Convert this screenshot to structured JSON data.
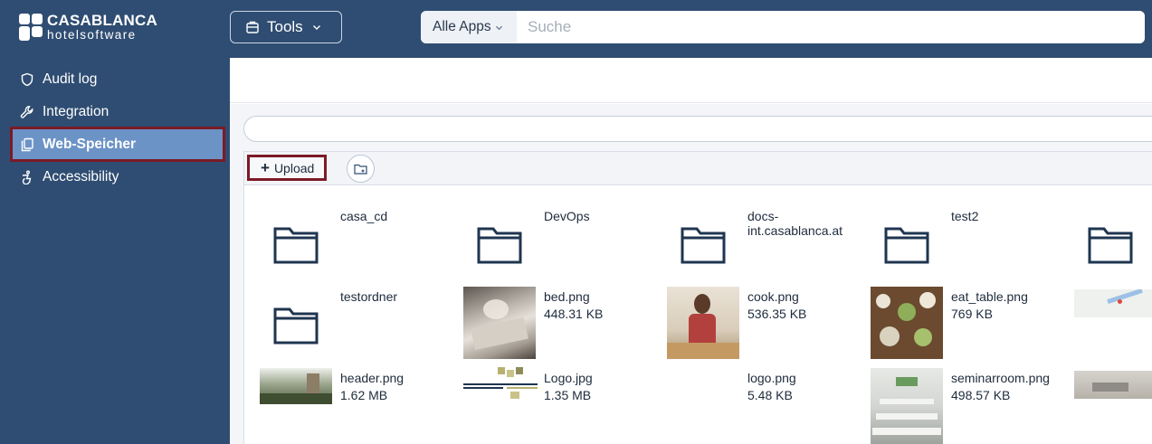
{
  "brand": {
    "name_line1": "CASABLANCA",
    "name_line2": "hotelsoftware"
  },
  "topbar": {
    "tools_label": "Tools",
    "search_scope": "Alle Apps",
    "search_placeholder": "Suche"
  },
  "sidebar": {
    "items": [
      {
        "label": "Audit log",
        "icon": "shield-icon"
      },
      {
        "label": "Integration",
        "icon": "wrench-icon"
      },
      {
        "label": "Web-Speicher",
        "icon": "files-icon",
        "active": true
      },
      {
        "label": "Accessibility",
        "icon": "accessibility-icon"
      }
    ]
  },
  "toolbar": {
    "upload_label": "Upload",
    "new_folder_icon": "folder-plus-icon"
  },
  "files": [
    {
      "name": "casa_cd",
      "type": "folder"
    },
    {
      "name": "DevOps",
      "type": "folder"
    },
    {
      "name": "docs-int.casablanca.at",
      "type": "folder"
    },
    {
      "name": "test2",
      "type": "folder"
    },
    {
      "name": "",
      "type": "folder"
    },
    {
      "name": "testordner",
      "type": "folder"
    },
    {
      "name": "bed.png",
      "size": "448.31 KB",
      "type": "image"
    },
    {
      "name": "cook.png",
      "size": "536.35 KB",
      "type": "image"
    },
    {
      "name": "eat_table.png",
      "size": "769 KB",
      "type": "image"
    },
    {
      "name": "",
      "type": "image"
    },
    {
      "name": "header.png",
      "size": "1.62 MB",
      "type": "image"
    },
    {
      "name": "Logo.jpg",
      "size": "1.35 MB",
      "type": "image"
    },
    {
      "name": "logo.png",
      "size": "5.48 KB",
      "type": "image"
    },
    {
      "name": "seminarroom.png",
      "size": "498.57 KB",
      "type": "image"
    },
    {
      "name": "",
      "type": "image"
    }
  ],
  "colors": {
    "navy": "#2f4d72",
    "active_nav": "#6c93c6",
    "highlight_border": "#7b1a26",
    "folder_stroke": "#1f3550"
  }
}
